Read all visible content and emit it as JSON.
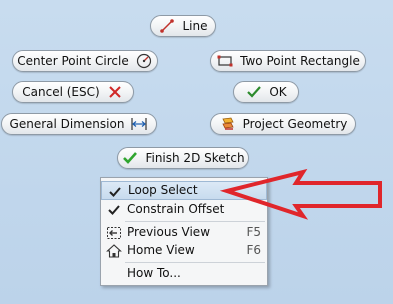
{
  "buttons": {
    "line": "Line",
    "center_point_circle": "Center Point Circle",
    "two_point_rectangle": "Two Point Rectangle",
    "cancel": "Cancel (ESC)",
    "ok": "OK",
    "general_dimension": "General Dimension",
    "project_geometry": "Project Geometry",
    "finish_2d_sketch": "Finish 2D Sketch"
  },
  "menu": {
    "items": [
      {
        "label": "Loop Select",
        "checked": true,
        "highlighted": true
      },
      {
        "label": "Constrain Offset",
        "checked": true
      },
      {
        "label": "Previous View",
        "shortcut": "F5",
        "icon": "previous-view-icon"
      },
      {
        "label": "Home View",
        "shortcut": "F6",
        "icon": "home-icon"
      },
      {
        "label": "How To..."
      }
    ]
  },
  "colors": {
    "annotation_arrow": "#e0262b",
    "cancel_x": "#d02828",
    "ok_check": "#2c8a2c",
    "line_icon": "#c0312b"
  }
}
